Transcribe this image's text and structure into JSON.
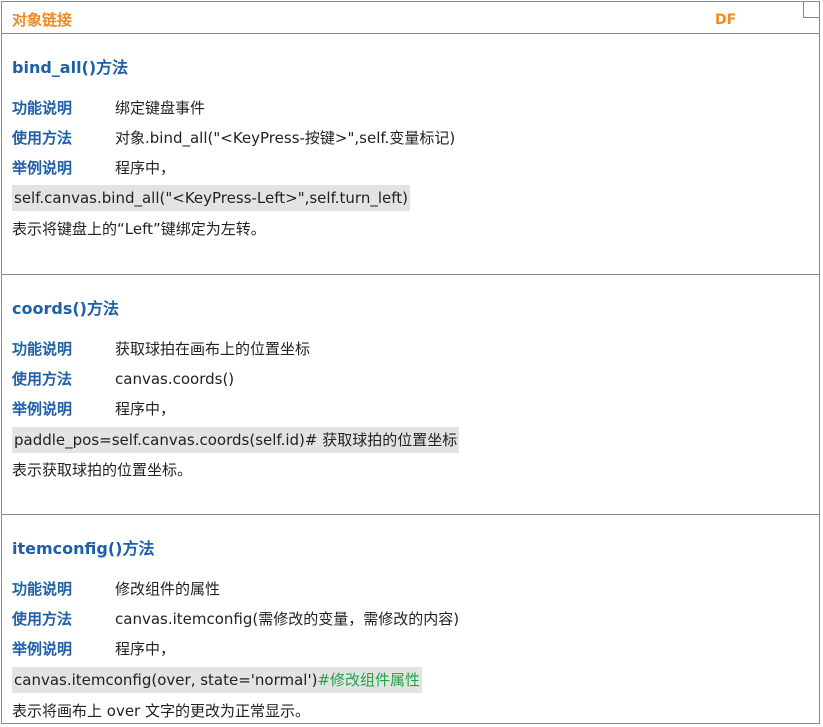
{
  "header": {
    "title": "对象链接",
    "corner": "DF"
  },
  "sections": [
    {
      "heading": "bind_all()方法",
      "func_label": "功能说明",
      "func_value": "绑定键盘事件",
      "usage_label": "使用方法",
      "usage_value": "对象.bind_all(\"<KeyPress-按键>\",self.变量标记)",
      "example_label": "举例说明",
      "example_value": "程序中，",
      "code": "self.canvas.bind_all(\"<KeyPress-Left>\",self.turn_left)",
      "code_comment": "",
      "note": "表示将键盘上的“Left”键绑定为左转。"
    },
    {
      "heading": "coords()方法",
      "func_label": "功能说明",
      "func_value": "获取球拍在画布上的位置坐标",
      "usage_label": "使用方法",
      "usage_value": "canvas.coords()",
      "example_label": "举例说明",
      "example_value": "程序中，",
      "code": "paddle_pos=self.canvas.coords(self.id)# 获取球拍的位置坐标",
      "code_comment": "",
      "note": "表示获取球拍的位置坐标。"
    },
    {
      "heading": "itemconfig()方法",
      "func_label": "功能说明",
      "func_value": "修改组件的属性",
      "usage_label": "使用方法",
      "usage_value": "canvas.itemconfig(需修改的变量，需修改的内容)",
      "example_label": "举例说明",
      "example_value": "程序中，",
      "code": "canvas.itemconfig(over, state='normal')",
      "code_comment": "#修改组件属性",
      "note": "表示将画布上 over 文字的更改为正常显示。"
    }
  ]
}
